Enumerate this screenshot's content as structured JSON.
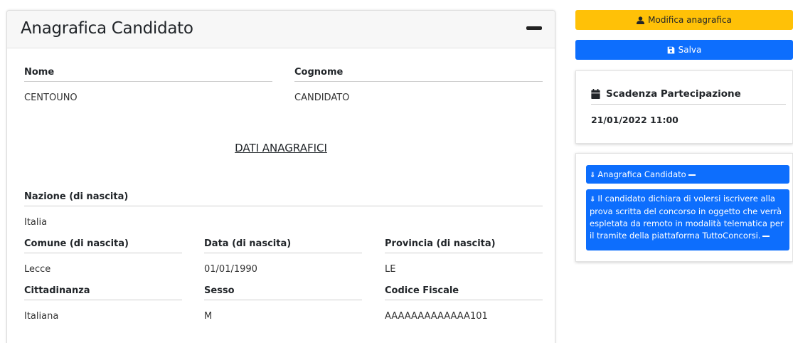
{
  "main": {
    "title": "Anagrafica Candidato",
    "fields": {
      "nome_label": "Nome",
      "nome_value": "CENTOUNO",
      "cognome_label": "Cognome",
      "cognome_value": "CANDIDATO"
    },
    "section_title": "DATI ANAGRAFICI",
    "anagrafica": {
      "nazione_label": "Nazione (di nascita)",
      "nazione_value": "Italia",
      "comune_label": "Comune (di nascita)",
      "comune_value": "Lecce",
      "data_label": "Data (di nascita)",
      "data_value": "01/01/1990",
      "provincia_label": "Provincia (di nascita)",
      "provincia_value": "LE",
      "cittadinanza_label": "Cittadinanza",
      "cittadinanza_value": "Italiana",
      "sesso_label": "Sesso",
      "sesso_value": "M",
      "cf_label": "Codice Fiscale",
      "cf_value": "AAAAAAAAAAAAA101"
    }
  },
  "sidebar": {
    "edit_button": "Modifica anagrafica",
    "save_button": "Salva",
    "deadline": {
      "title": "Scadenza Partecipazione",
      "value": "21/01/2022 11:00"
    },
    "info": {
      "chip1": "Anagrafica Candidato",
      "chip2": "Il candidato dichiara di volersi iscrivere alla prova scritta del concorso in oggetto che verrà espletata da remoto in modalità telematica per il tramite della piattaforma TuttoConcorsi."
    }
  },
  "colors": {
    "warning": "#ffc107",
    "primary": "#0d6efd"
  },
  "icons": [
    "user-icon",
    "save-icon",
    "calendar-icon",
    "chevron-double-down-icon",
    "minus-icon"
  ]
}
